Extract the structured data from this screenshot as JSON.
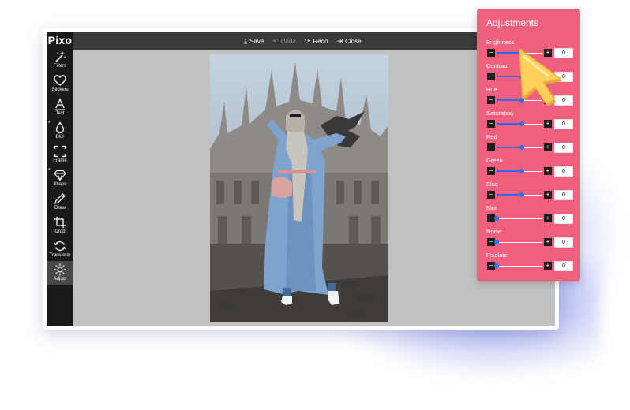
{
  "app": {
    "logo": "Pixo"
  },
  "toolbar": {
    "save_label": "Save",
    "undo_label": "Undo",
    "redo_label": "Redo",
    "close_label": "Close"
  },
  "sidebar": {
    "items": [
      {
        "label": "Filters",
        "icon": "magic-wand-icon",
        "starred": false,
        "active": false
      },
      {
        "label": "Stickers",
        "icon": "heart-icon",
        "starred": false,
        "active": false
      },
      {
        "label": "Text",
        "icon": "text-icon",
        "starred": false,
        "active": false
      },
      {
        "label": "Blur",
        "icon": "droplet-icon",
        "starred": true,
        "active": false
      },
      {
        "label": "Frame",
        "icon": "frame-icon",
        "starred": false,
        "active": false
      },
      {
        "label": "Shape",
        "icon": "diamond-icon",
        "starred": true,
        "active": false
      },
      {
        "label": "Draw",
        "icon": "pencil-icon",
        "starred": false,
        "active": false
      },
      {
        "label": "Crop",
        "icon": "crop-icon",
        "starred": false,
        "active": false
      },
      {
        "label": "Transform",
        "icon": "rotate-icon",
        "starred": false,
        "active": false
      },
      {
        "label": "Adjust",
        "icon": "sun-icon",
        "starred": false,
        "active": true
      }
    ],
    "star_symbol": "*"
  },
  "panel": {
    "title": "Adjustments",
    "minus_symbol": "−",
    "plus_symbol": "+",
    "adjustments": [
      {
        "label": "Brightness",
        "value": "0",
        "level": 0.55
      },
      {
        "label": "Contrast",
        "value": "0",
        "level": 0.55
      },
      {
        "label": "Hue",
        "value": "0",
        "level": 0.55
      },
      {
        "label": "Saturation",
        "value": "0",
        "level": 0.55
      },
      {
        "label": "Red",
        "value": "0",
        "level": 0.55
      },
      {
        "label": "Green",
        "value": "0",
        "level": 0.55
      },
      {
        "label": "Blue",
        "value": "0",
        "level": 0.55
      },
      {
        "label": "Blur",
        "value": "0",
        "level": 0.0
      },
      {
        "label": "Noise",
        "value": "0",
        "level": 0.0
      },
      {
        "label": "Pixelate",
        "value": "0",
        "level": 0.0
      }
    ]
  },
  "colors": {
    "panel": "#f15f7e",
    "accent": "#2d6cf2",
    "sidebar": "#1a1a1a",
    "topbar": "#3a3a3a",
    "canvas": "#c1c1c1",
    "cursor": "#ffd15a"
  }
}
